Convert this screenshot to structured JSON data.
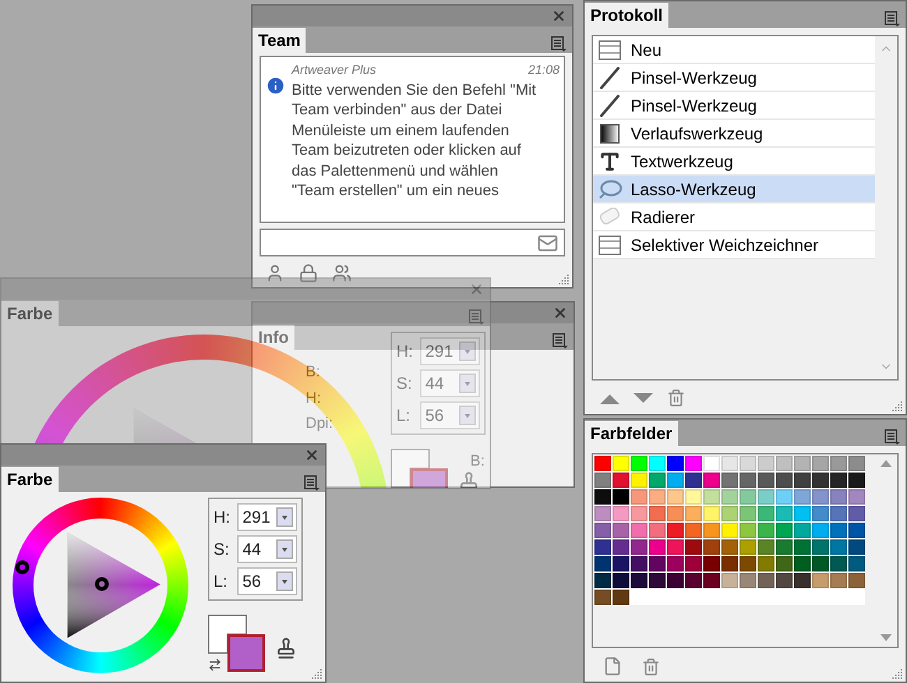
{
  "team": {
    "tab": "Team",
    "message": {
      "sender": "Artweaver Plus",
      "time": "21:08",
      "text": "Bitte verwenden Sie den Befehl \"Mit Team verbinden\" aus der Datei Menüleiste um einem laufenden Team beizutreten oder klicken auf das Palettenmenü und wählen \"Team erstellen\" um ein neues"
    }
  },
  "info": {
    "tab": "Info",
    "labels": [
      "B:",
      "H:",
      "Dpi:"
    ],
    "side_label": "B:"
  },
  "color_ghost": {
    "tab": "Farbe",
    "fields": [
      {
        "label": "H:",
        "value": "291"
      },
      {
        "label": "S:",
        "value": "44"
      },
      {
        "label": "L:",
        "value": "56"
      }
    ]
  },
  "color": {
    "tab": "Farbe",
    "fields": [
      {
        "label": "H:",
        "value": "291"
      },
      {
        "label": "S:",
        "value": "44"
      },
      {
        "label": "L:",
        "value": "56"
      }
    ]
  },
  "history": {
    "tab": "Protokoll",
    "items": [
      {
        "label": "Neu",
        "kind": "document",
        "selected": false
      },
      {
        "label": "Pinsel-Werkzeug",
        "kind": "brush",
        "selected": false
      },
      {
        "label": "Pinsel-Werkzeug",
        "kind": "brush",
        "selected": false
      },
      {
        "label": "Verlaufswerkzeug",
        "kind": "gradient",
        "selected": false
      },
      {
        "label": "Textwerkzeug",
        "kind": "text",
        "selected": false
      },
      {
        "label": "Lasso-Werkzeug",
        "kind": "lasso",
        "selected": true
      },
      {
        "label": "Radierer",
        "kind": "eraser",
        "selected": false
      },
      {
        "label": "Selektiver Weichzeichner",
        "kind": "document",
        "selected": false
      }
    ]
  },
  "swatches": {
    "tab": "Farbfelder",
    "colors": [
      {
        "color": "#ff0000"
      },
      {
        "color": "#ffff00"
      },
      {
        "color": "#00ff00"
      },
      {
        "color": "#00ffff"
      },
      {
        "color": "#0000ff"
      },
      {
        "color": "#ff00ff"
      },
      {
        "color": "#ffffff"
      },
      {
        "color": "#e6e6e6"
      },
      {
        "color": "#d9d9d9"
      },
      {
        "color": "#cccccc"
      },
      {
        "color": "#bfbfbf"
      },
      {
        "color": "#b3b3b3"
      },
      {
        "color": "#a6a6a6"
      },
      {
        "color": "#999999"
      },
      {
        "color": "#8c8c8c"
      },
      {
        "color": "#808080"
      },
      {
        "color": "#e0102f"
      },
      {
        "color": "#fff200"
      },
      {
        "color": "#00a86b"
      },
      {
        "color": "#00aeef"
      },
      {
        "color": "#2e3192"
      },
      {
        "color": "#ec008c"
      },
      {
        "color": "#737373"
      },
      {
        "color": "#666666"
      },
      {
        "color": "#595959"
      },
      {
        "color": "#4d4d4d"
      },
      {
        "color": "#404040"
      },
      {
        "color": "#333333"
      },
      {
        "color": "#262626"
      },
      {
        "color": "#1a1a1a"
      },
      {
        "color": "#0d0d0d"
      },
      {
        "color": "#000000"
      },
      {
        "color": "#f7977a"
      },
      {
        "color": "#f9ad81"
      },
      {
        "color": "#fdc68a"
      },
      {
        "color": "#fff79a"
      },
      {
        "color": "#c4df9b"
      },
      {
        "color": "#a3d39c"
      },
      {
        "color": "#82ca9d"
      },
      {
        "color": "#7bcdc8"
      },
      {
        "color": "#6ecff6"
      },
      {
        "color": "#7ea7d8"
      },
      {
        "color": "#8493ca"
      },
      {
        "color": "#8882be"
      },
      {
        "color": "#a187be"
      },
      {
        "color": "#bc8dbf"
      },
      {
        "color": "#f49ac2"
      },
      {
        "color": "#f6989d"
      },
      {
        "color": "#f26c4f"
      },
      {
        "color": "#f68e55"
      },
      {
        "color": "#fbaf5c"
      },
      {
        "color": "#fff467"
      },
      {
        "color": "#acd372"
      },
      {
        "color": "#7cc576"
      },
      {
        "color": "#3bb878"
      },
      {
        "color": "#1abbb4"
      },
      {
        "color": "#00bff3"
      },
      {
        "color": "#438ccb"
      },
      {
        "color": "#5574b9"
      },
      {
        "color": "#605ca8"
      },
      {
        "color": "#855fa8"
      },
      {
        "color": "#a763a8"
      },
      {
        "color": "#f06ea9"
      },
      {
        "color": "#f26d7d"
      },
      {
        "color": "#ed1c24"
      },
      {
        "color": "#f26522"
      },
      {
        "color": "#f7941d"
      },
      {
        "color": "#fff100"
      },
      {
        "color": "#8dc63f"
      },
      {
        "color": "#39b54a"
      },
      {
        "color": "#00a651"
      },
      {
        "color": "#00a99d"
      },
      {
        "color": "#00adef"
      },
      {
        "color": "#0072bc"
      },
      {
        "color": "#0054a6"
      },
      {
        "color": "#2e3191"
      },
      {
        "color": "#662d91"
      },
      {
        "color": "#92278f"
      },
      {
        "color": "#ec008b"
      },
      {
        "color": "#ed145b"
      },
      {
        "color": "#9e0b0f"
      },
      {
        "color": "#a0410d"
      },
      {
        "color": "#a36209"
      },
      {
        "color": "#aba000"
      },
      {
        "color": "#598527"
      },
      {
        "color": "#197b30"
      },
      {
        "color": "#007236"
      },
      {
        "color": "#00746b"
      },
      {
        "color": "#0076a3"
      },
      {
        "color": "#004a80"
      },
      {
        "color": "#003471"
      },
      {
        "color": "#1b1464"
      },
      {
        "color": "#440e62"
      },
      {
        "color": "#630460"
      },
      {
        "color": "#9e005d"
      },
      {
        "color": "#9e0039"
      },
      {
        "color": "#790000"
      },
      {
        "color": "#7b2e00"
      },
      {
        "color": "#7d4900"
      },
      {
        "color": "#827b00"
      },
      {
        "color": "#406618"
      },
      {
        "color": "#005e20"
      },
      {
        "color": "#005826"
      },
      {
        "color": "#005952"
      },
      {
        "color": "#005b7f"
      },
      {
        "color": "#002b45"
      },
      {
        "color": "#0d0d3a"
      },
      {
        "color": "#1b0a3a"
      },
      {
        "color": "#2d0a3a"
      },
      {
        "color": "#3d0035"
      },
      {
        "color": "#5a0030"
      },
      {
        "color": "#6b0020"
      },
      {
        "color": "#c7b299"
      },
      {
        "color": "#998675"
      },
      {
        "color": "#736357"
      },
      {
        "color": "#534741"
      },
      {
        "color": "#37302d"
      },
      {
        "color": "#c69c6d"
      },
      {
        "color": "#a67c52"
      },
      {
        "color": "#8c6239"
      },
      {
        "color": "#754c24"
      },
      {
        "color": "#603913"
      }
    ]
  }
}
